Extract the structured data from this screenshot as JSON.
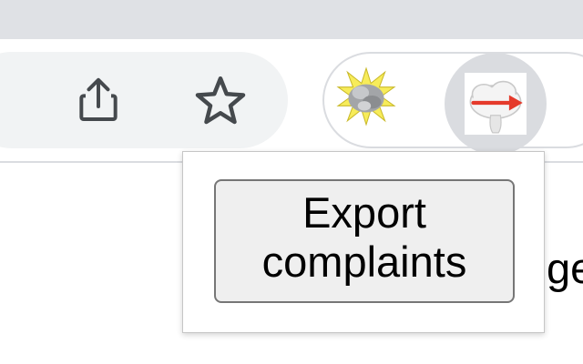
{
  "browser": {
    "toolbar": {
      "share_icon": "share-icon",
      "bookmark_icon": "star-icon"
    },
    "extensions": [
      {
        "icon": "explosion-icon"
      },
      {
        "icon": "cloud-arrow-icon",
        "active": true
      }
    ]
  },
  "popup": {
    "export_button_label": "Export complaints"
  },
  "page": {
    "text_fragment": "ge"
  },
  "colors": {
    "tab_strip": "#dfe1e5",
    "omnibox": "#f1f3f4",
    "active_extension_bg": "#dadce0",
    "button_bg": "#efefef",
    "button_border": "#767676",
    "arrow_red": "#e53a2b"
  }
}
